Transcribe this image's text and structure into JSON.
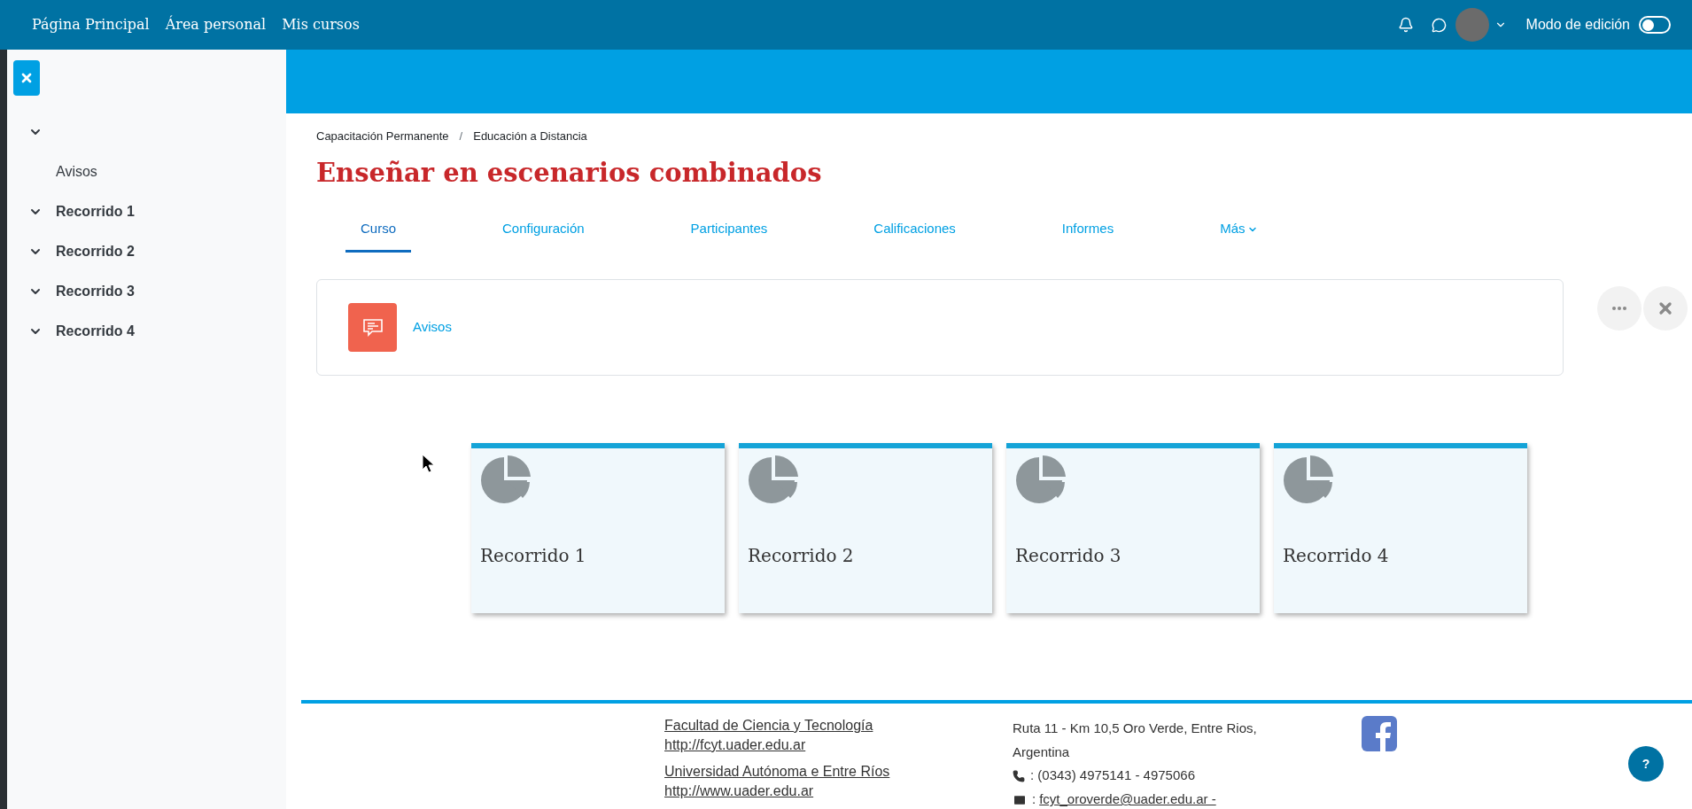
{
  "navbar": {
    "links": [
      "Página Principal",
      "Área personal",
      "Mis cursos"
    ],
    "edit_mode": {
      "label": "Modo de edición",
      "on": false
    }
  },
  "sidebar": {
    "items": [
      {
        "expanded": true,
        "children": [
          {
            "label": "Avisos"
          }
        ]
      },
      {
        "label": "Recorrido 1",
        "expanded": true
      },
      {
        "label": "Recorrido 2",
        "expanded": true
      },
      {
        "label": "Recorrido 3",
        "expanded": true
      },
      {
        "label": "Recorrido 4",
        "expanded": true
      }
    ]
  },
  "breadcrumb": {
    "separator": "/",
    "items": [
      "Capacitación Permanente",
      "Educación a Distancia"
    ]
  },
  "course_title": "Enseñar en escenarios combinados",
  "tabs": [
    {
      "label": "Curso",
      "selected": true
    },
    {
      "label": "Configuración",
      "selected": false
    },
    {
      "label": "Participantes",
      "selected": false
    },
    {
      "label": "Calificaciones",
      "selected": false
    },
    {
      "label": "Informes",
      "selected": false
    },
    {
      "label": "Más",
      "selected": false,
      "dropdown": true
    }
  ],
  "activity": {
    "label": "Avisos"
  },
  "sections": [
    {
      "title": "Recorrido 1"
    },
    {
      "title": "Recorrido 2"
    },
    {
      "title": "Recorrido 3"
    },
    {
      "title": "Recorrido 4"
    }
  ],
  "footer": {
    "links": [
      {
        "name": "Facultad de Ciencia y Tecnología",
        "url": "http://fcyt.uader.edu.ar"
      },
      {
        "name": "Universidad Autónoma e Entre Ríos",
        "url": "http://www.uader.edu.ar"
      }
    ],
    "address": "Ruta 11 - Km 10,5 Oro Verde, Entre Rios, Argentina",
    "phone": ": (0343) 4975141 - 4975066",
    "email_prefix": ":",
    "email": "fcyt_oroverde@uader.edu.ar -"
  },
  "help": {
    "label": "?"
  }
}
